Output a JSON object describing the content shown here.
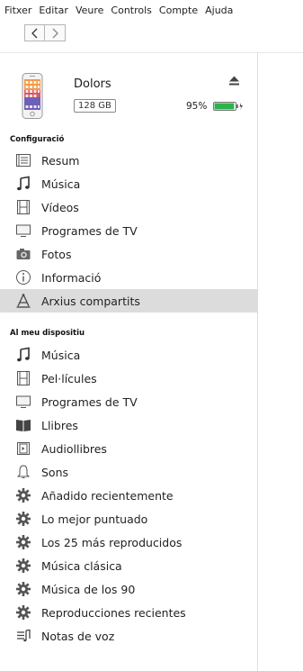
{
  "menu": [
    "Fitxer",
    "Editar",
    "Veure",
    "Controls",
    "Compte",
    "Ajuda"
  ],
  "device": {
    "name": "Dolors",
    "capacity": "128 GB",
    "battery_percent": "95%",
    "battery_level": 0.95
  },
  "colors": {
    "battery_fill": "#2bb34b",
    "selected_row": "#dcdcdc",
    "icon": "#555555"
  },
  "sections": {
    "config": "Configuració",
    "device": "Al meu dispositiu"
  },
  "config_items": [
    {
      "label": "Resum",
      "icon": "summary-icon"
    },
    {
      "label": "Música",
      "icon": "music-note-icon"
    },
    {
      "label": "Vídeos",
      "icon": "film-icon"
    },
    {
      "label": "Programes de TV",
      "icon": "tv-icon"
    },
    {
      "label": "Fotos",
      "icon": "camera-icon"
    },
    {
      "label": "Informació",
      "icon": "info-icon"
    },
    {
      "label": "Arxius compartits",
      "icon": "shared-files-icon",
      "selected": true
    }
  ],
  "device_items": [
    {
      "label": "Música",
      "icon": "music-note-icon"
    },
    {
      "label": "Pel·lícules",
      "icon": "film-icon"
    },
    {
      "label": "Programes de TV",
      "icon": "tv-icon"
    },
    {
      "label": "Llibres",
      "icon": "book-icon"
    },
    {
      "label": "Audiollibres",
      "icon": "audiobook-icon"
    },
    {
      "label": "Sons",
      "icon": "bell-icon"
    },
    {
      "label": "Añadido recientemente",
      "icon": "gear-icon"
    },
    {
      "label": "Lo mejor puntuado",
      "icon": "gear-icon"
    },
    {
      "label": "Los 25 más reproducidos",
      "icon": "gear-icon"
    },
    {
      "label": "Música clásica",
      "icon": "gear-icon"
    },
    {
      "label": "Música de los 90",
      "icon": "gear-icon"
    },
    {
      "label": "Reproducciones recientes",
      "icon": "gear-icon"
    },
    {
      "label": "Notas de voz",
      "icon": "voice-memo-icon"
    }
  ]
}
